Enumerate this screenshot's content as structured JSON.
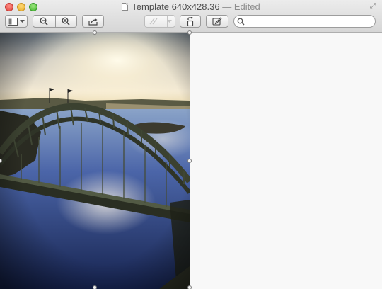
{
  "window": {
    "title": "Template 640x428.36",
    "edited_suffix": "— Edited"
  },
  "toolbar": {
    "sidebar_button_icon": "sidebar-icon",
    "zoom_out_icon": "zoom-out-icon",
    "zoom_in_icon": "zoom-in-icon",
    "share_icon": "share-icon",
    "annotate_icon": "annotate-pen-icon",
    "rotate_icon": "rotate-icon",
    "markup_icon": "markup-toolbox-icon"
  },
  "search": {
    "placeholder": "",
    "value": ""
  },
  "image": {
    "description_icon": "photo-bridge-sunset"
  },
  "colors": {
    "sky_top": "#7a8794",
    "sky_glow": "#fff4d6",
    "water": "#2f4a8a",
    "bridge": "#3b4130"
  }
}
